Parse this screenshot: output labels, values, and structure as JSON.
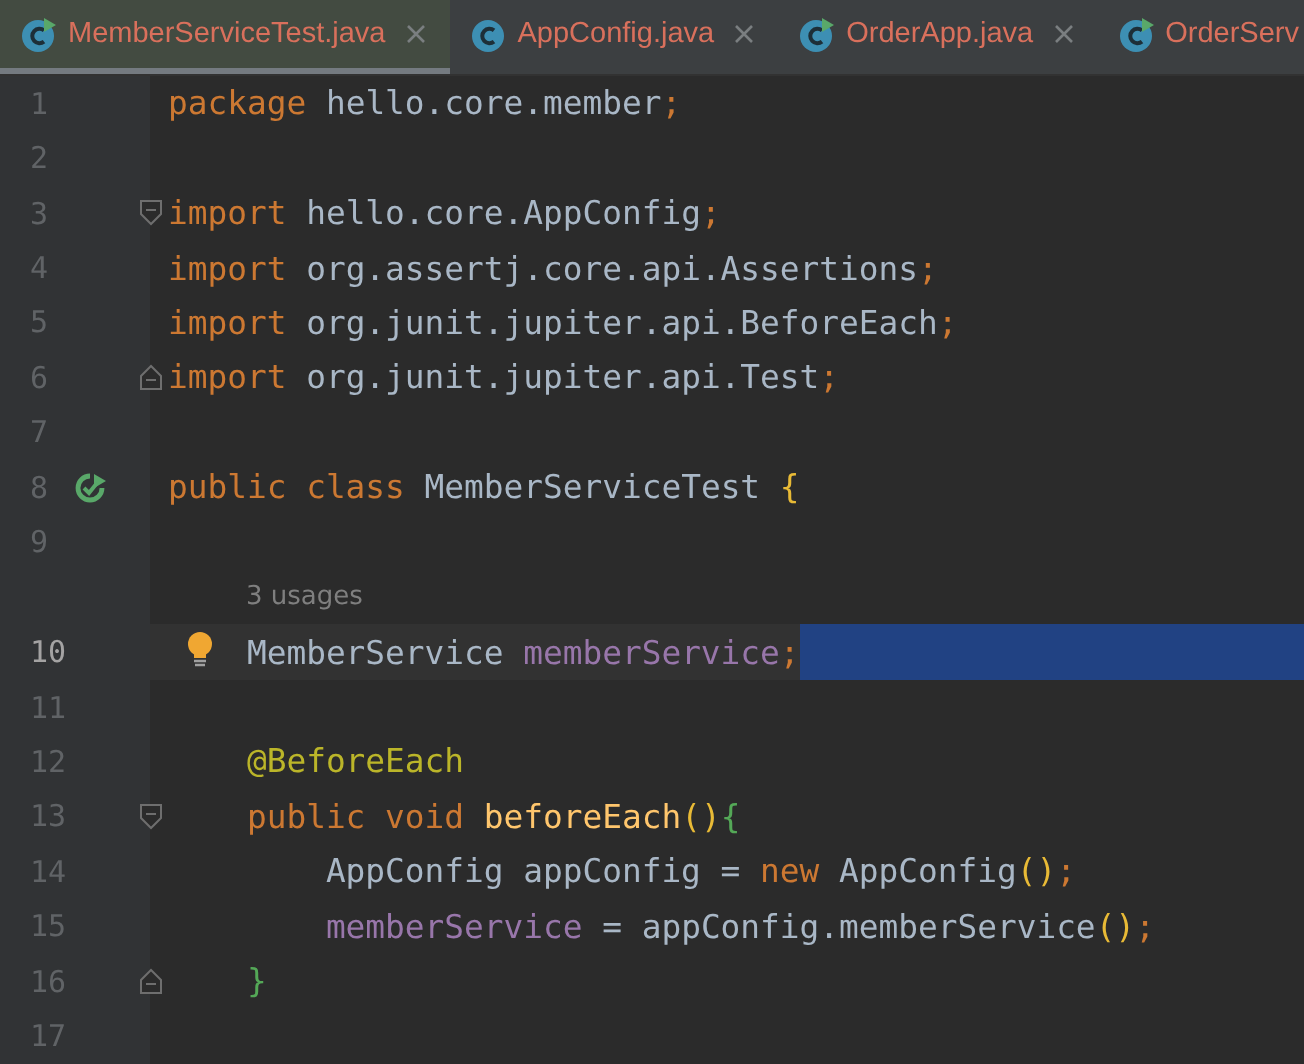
{
  "tabs": [
    {
      "label": "MemberServiceTest.java",
      "selected": true,
      "runnable": true,
      "closable": true
    },
    {
      "label": "AppConfig.java",
      "selected": false,
      "runnable": false,
      "closable": true
    },
    {
      "label": "OrderApp.java",
      "selected": false,
      "runnable": true,
      "closable": true
    },
    {
      "label": "OrderServ",
      "selected": false,
      "runnable": true,
      "closable": false
    }
  ],
  "rows": [
    {
      "kind": "code",
      "number": "1",
      "current": false,
      "tokens": [
        {
          "kind": "keyword",
          "t": "package "
        },
        {
          "kind": "plain",
          "t": "hello.core.member"
        },
        {
          "kind": "punct",
          "t": ";"
        }
      ]
    },
    {
      "kind": "code",
      "number": "2",
      "current": false,
      "tokens": []
    },
    {
      "kind": "code",
      "number": "3",
      "current": false,
      "icon": {
        "kind": "fold-open"
      },
      "tokens": [
        {
          "kind": "keyword",
          "t": "import "
        },
        {
          "kind": "plain",
          "t": "hello.core.AppConfig"
        },
        {
          "kind": "punct",
          "t": ";"
        }
      ]
    },
    {
      "kind": "code",
      "number": "4",
      "current": false,
      "tokens": [
        {
          "kind": "keyword",
          "t": "import "
        },
        {
          "kind": "plain",
          "t": "org.assertj.core.api.Assertions"
        },
        {
          "kind": "punct",
          "t": ";"
        }
      ]
    },
    {
      "kind": "code",
      "number": "5",
      "current": false,
      "tokens": [
        {
          "kind": "keyword",
          "t": "import "
        },
        {
          "kind": "plain",
          "t": "org.junit.jupiter.api.BeforeEach"
        },
        {
          "kind": "punct",
          "t": ";"
        }
      ]
    },
    {
      "kind": "code",
      "number": "6",
      "current": false,
      "icon": {
        "kind": "fold-close"
      },
      "tokens": [
        {
          "kind": "keyword",
          "t": "import "
        },
        {
          "kind": "plain",
          "t": "org.junit.jupiter.api.Test"
        },
        {
          "kind": "punct",
          "t": ";"
        }
      ]
    },
    {
      "kind": "code",
      "number": "7",
      "current": false,
      "tokens": []
    },
    {
      "kind": "code",
      "number": "8",
      "current": false,
      "icon": {
        "kind": "run"
      },
      "tokens": [
        {
          "kind": "keyword",
          "t": "public class "
        },
        {
          "kind": "plain",
          "t": "MemberServiceTest "
        },
        {
          "kind": "paren",
          "t": "{"
        }
      ]
    },
    {
      "kind": "code",
      "number": "9",
      "current": false,
      "tokens": []
    },
    {
      "kind": "inlay",
      "text": "3 usages"
    },
    {
      "kind": "code",
      "number": "10",
      "current": true,
      "icon": {
        "kind": "bulb"
      },
      "selection_to_end": true,
      "tokens": [
        {
          "kind": "plain",
          "t": "    MemberService "
        },
        {
          "kind": "field",
          "t": "memberService"
        },
        {
          "kind": "punct",
          "t": ";"
        }
      ]
    },
    {
      "kind": "code",
      "number": "11",
      "current": false,
      "tokens": []
    },
    {
      "kind": "code",
      "number": "12",
      "current": false,
      "tokens": [
        {
          "kind": "annotation",
          "t": "    @BeforeEach"
        }
      ]
    },
    {
      "kind": "code",
      "number": "13",
      "current": false,
      "icon": {
        "kind": "fold-open"
      },
      "tokens": [
        {
          "kind": "keyword",
          "t": "    public void "
        },
        {
          "kind": "method",
          "t": "beforeEach"
        },
        {
          "kind": "paren",
          "t": "()"
        },
        {
          "kind": "brace",
          "t": "{"
        }
      ]
    },
    {
      "kind": "code",
      "number": "14",
      "current": false,
      "tokens": [
        {
          "kind": "plain",
          "t": "        AppConfig appConfig = "
        },
        {
          "kind": "keyword",
          "t": "new "
        },
        {
          "kind": "plain",
          "t": "AppConfig"
        },
        {
          "kind": "paren",
          "t": "()"
        },
        {
          "kind": "punct",
          "t": ";"
        }
      ]
    },
    {
      "kind": "code",
      "number": "15",
      "current": false,
      "tokens": [
        {
          "kind": "field",
          "t": "        memberService"
        },
        {
          "kind": "plain",
          "t": " = appConfig.memberService"
        },
        {
          "kind": "paren",
          "t": "()"
        },
        {
          "kind": "punct",
          "t": ";"
        }
      ]
    },
    {
      "kind": "code",
      "number": "16",
      "current": false,
      "icon": {
        "kind": "fold-close"
      },
      "tokens": [
        {
          "kind": "brace",
          "t": "    }"
        }
      ]
    },
    {
      "kind": "code",
      "number": "17",
      "current": false,
      "tokens": []
    }
  ]
}
